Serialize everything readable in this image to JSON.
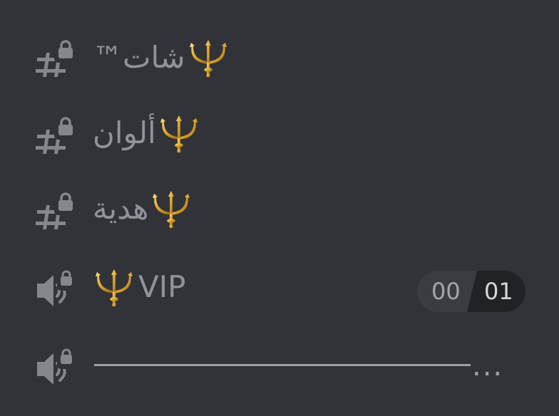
{
  "channels": [
    {
      "type": "text-locked",
      "icon": "hash-lock-icon",
      "emoji": "trident-icon",
      "name": "شات™"
    },
    {
      "type": "text-locked",
      "icon": "hash-lock-icon",
      "emoji": "trident-icon",
      "name": "ألوان"
    },
    {
      "type": "text-locked",
      "icon": "hash-lock-icon",
      "emoji": "trident-icon",
      "name": "هدية"
    },
    {
      "type": "voice-locked",
      "icon": "speaker-lock-icon",
      "emoji": "trident-icon",
      "name": "VIP",
      "user_count": "00",
      "user_limit": "01"
    },
    {
      "type": "voice-locked",
      "icon": "speaker-lock-icon",
      "name": "...",
      "truncated": true
    }
  ],
  "colors": {
    "background": "#313338",
    "icon": "#84878c",
    "text": "#909398",
    "pill_left": "#3a3c41",
    "pill_right": "#212226",
    "trident_gold": "#d9a22a"
  }
}
